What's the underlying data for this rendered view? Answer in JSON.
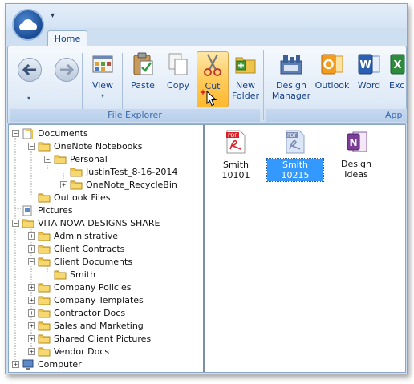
{
  "qat": {
    "dropdown_glyph": "▾"
  },
  "tabs": [
    {
      "label": "Home",
      "active": true
    }
  ],
  "ribbon": {
    "groups": [
      {
        "label": "File Explorer"
      },
      {
        "label": "App"
      }
    ],
    "buttons": {
      "view": "View",
      "paste": "Paste",
      "copy": "Copy",
      "cut": "Cut",
      "new_folder_line1": "New",
      "new_folder_line2": "Folder",
      "design_manager_line1": "Design",
      "design_manager_line2": "Manager",
      "outlook": "Outlook",
      "word": "Word",
      "excel": "Exc"
    },
    "active_button": "cut"
  },
  "tree": {
    "items": [
      {
        "label": "Documents",
        "expander": "-"
      },
      {
        "label": "OneNote Notebooks",
        "expander": "-"
      },
      {
        "label": "Personal",
        "expander": "-"
      },
      {
        "label": "JustinTest_8-16-2014",
        "expander": ""
      },
      {
        "label": "OneNote_RecycleBin",
        "expander": "+"
      },
      {
        "label": "Outlook Files",
        "expander": ""
      },
      {
        "label": "Pictures",
        "expander": ""
      },
      {
        "label": "VITA NOVA DESIGNS SHARE",
        "expander": "-"
      },
      {
        "label": "Administrative",
        "expander": "+"
      },
      {
        "label": "Client Contracts",
        "expander": "+"
      },
      {
        "label": "Client Documents",
        "expander": "-"
      },
      {
        "label": "Smith",
        "expander": ""
      },
      {
        "label": "Company Policies",
        "expander": "+"
      },
      {
        "label": "Company Templates",
        "expander": "+"
      },
      {
        "label": "Contractor Docs",
        "expander": "+"
      },
      {
        "label": "Sales and Marketing",
        "expander": "+"
      },
      {
        "label": "Shared Client Pictures",
        "expander": "+"
      },
      {
        "label": "Vendor Docs",
        "expander": "+"
      },
      {
        "label": "Computer",
        "expander": "+"
      }
    ]
  },
  "files": [
    {
      "label": "Smith 10101",
      "icon": "pdf-icon",
      "selected": false
    },
    {
      "label": "Smith 10215",
      "icon": "pdf-icon",
      "selected": true
    },
    {
      "label_line1": "Design",
      "label_line2": "Ideas",
      "icon": "onenote-icon",
      "selected": false
    }
  ],
  "colors": {
    "accent": "#15428b",
    "selection": "#3399ff",
    "cut_active": "#ffcb5b",
    "folder": "#e8c24a",
    "pdf_red": "#d8232a"
  }
}
